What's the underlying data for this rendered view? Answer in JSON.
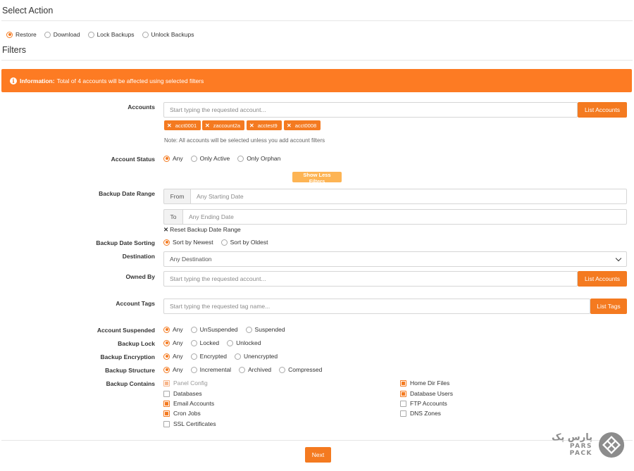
{
  "select_action": {
    "title": "Select Action",
    "options": [
      {
        "label": "Restore",
        "checked": true
      },
      {
        "label": "Download",
        "checked": false
      },
      {
        "label": "Lock Backups",
        "checked": false
      },
      {
        "label": "Unlock Backups",
        "checked": false
      }
    ]
  },
  "filters": {
    "title": "Filters",
    "info": {
      "strong": "Information:",
      "text": "Total of 4 accounts will be affected using selected filters"
    },
    "accounts": {
      "label": "Accounts",
      "placeholder": "Start typing the requested account...",
      "button": "List Accounts",
      "tags": [
        "acct0001",
        "zaccount2a",
        "acctest9",
        "acct0008"
      ],
      "note": "Note: All accounts will be selected unless you add account filters"
    },
    "account_status": {
      "label": "Account Status",
      "options": [
        {
          "label": "Any",
          "checked": true
        },
        {
          "label": "Only Active",
          "checked": false
        },
        {
          "label": "Only Orphan",
          "checked": false
        }
      ]
    },
    "show_less": "Show Less Filters",
    "date_range": {
      "label": "Backup Date Range",
      "from_label": "From",
      "from_placeholder": "Any Starting Date",
      "to_label": "To",
      "to_placeholder": "Any Ending Date",
      "reset": "Reset Backup Date Range"
    },
    "date_sorting": {
      "label": "Backup Date Sorting",
      "options": [
        {
          "label": "Sort by Newest",
          "checked": true
        },
        {
          "label": "Sort by Oldest",
          "checked": false
        }
      ]
    },
    "destination": {
      "label": "Destination",
      "value": "Any Destination"
    },
    "owned_by": {
      "label": "Owned By",
      "placeholder": "Start typing the requested account...",
      "button": "List Accounts"
    },
    "account_tags": {
      "label": "Account Tags",
      "placeholder": "Start typing the requested tag name...",
      "button": "List Tags"
    },
    "account_suspended": {
      "label": "Account Suspended",
      "options": [
        {
          "label": "Any",
          "checked": true
        },
        {
          "label": "UnSuspended",
          "checked": false
        },
        {
          "label": "Suspended",
          "checked": false
        }
      ]
    },
    "backup_lock": {
      "label": "Backup Lock",
      "options": [
        {
          "label": "Any",
          "checked": true
        },
        {
          "label": "Locked",
          "checked": false
        },
        {
          "label": "Unlocked",
          "checked": false
        }
      ]
    },
    "backup_encryption": {
      "label": "Backup Encryption",
      "options": [
        {
          "label": "Any",
          "checked": true
        },
        {
          "label": "Encrypted",
          "checked": false
        },
        {
          "label": "Unencrypted",
          "checked": false
        }
      ]
    },
    "backup_structure": {
      "label": "Backup Structure",
      "options": [
        {
          "label": "Any",
          "checked": true
        },
        {
          "label": "Incremental",
          "checked": false
        },
        {
          "label": "Archived",
          "checked": false
        },
        {
          "label": "Compressed",
          "checked": false
        }
      ]
    },
    "backup_contains": {
      "label": "Backup Contains",
      "items": [
        {
          "label": "Panel Config",
          "checked": true,
          "disabled": true
        },
        {
          "label": "Home Dir Files",
          "checked": true,
          "disabled": false
        },
        {
          "label": "Databases",
          "checked": false,
          "disabled": false
        },
        {
          "label": "Database Users",
          "checked": true,
          "disabled": false
        },
        {
          "label": "Email Accounts",
          "checked": true,
          "disabled": false
        },
        {
          "label": "FTP Accounts",
          "checked": false,
          "disabled": false
        },
        {
          "label": "Cron Jobs",
          "checked": true,
          "disabled": false
        },
        {
          "label": "DNS Zones",
          "checked": false,
          "disabled": false
        },
        {
          "label": "SSL Certificates",
          "checked": false,
          "disabled": false
        }
      ]
    }
  },
  "next_button": "Next",
  "watermark": {
    "fa": "پارس پک",
    "en": "PARS PACK"
  },
  "colors": {
    "accent": "#f47a20",
    "info_bar": "#fd7b23",
    "show_less": "#fdb454"
  }
}
